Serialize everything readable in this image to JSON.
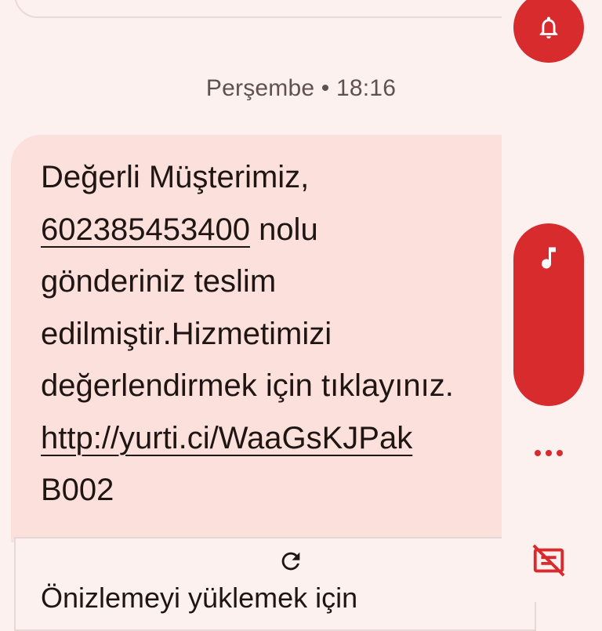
{
  "timestamp": "Perşembe • 18:16",
  "message": {
    "lines": [
      "Değerli Müşterimiz,",
      "602385453400",
      " nolu",
      "gönderiniz teslim",
      "edilmiştir.Hizmetimizi",
      "değerlendirmek için tıklayınız.",
      "http://yurti.ci/WaaGsKJPak",
      "B002"
    ]
  },
  "preview": {
    "text": "Önizlemeyi yüklemek için"
  },
  "icons": {
    "bell": "bell-icon",
    "music": "music-note-icon",
    "more": "more-horizontal-icon",
    "hide_preview": "hide-preview-icon",
    "refresh": "refresh-icon"
  },
  "colors": {
    "accent": "#d72b2e",
    "bubble": "#fbe0dc",
    "background": "#fdf1ef"
  }
}
